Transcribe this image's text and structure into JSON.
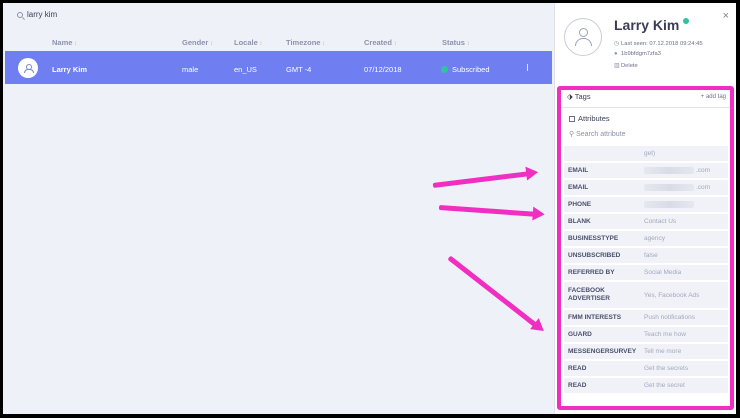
{
  "search": {
    "query": "larry kim"
  },
  "columns": [
    "Name",
    "Gender",
    "Locale",
    "Timezone",
    "Created",
    "Status"
  ],
  "row": {
    "name": "Larry Kim",
    "gender": "male",
    "locale": "en_US",
    "timezone": "GMT -4",
    "created": "07/12/2018",
    "status": "Subscribed",
    "status_color": "#2fc3a1"
  },
  "panel": {
    "name": "Larry Kim",
    "last_seen": "Last seen: 07.12.2018 09:24:45",
    "user_id": "1b9bfdgm7zfa3",
    "delete_label": "Delete",
    "close_label": "×",
    "tags_label": "Tags",
    "add_tag_label": "add tag",
    "attributes_label": "Attributes",
    "search_placeholder": "Search attribute",
    "partial_value": "get)",
    "attributes": [
      {
        "key": "EMAIL",
        "value": ".com",
        "masked": true
      },
      {
        "key": "EMAIL",
        "value": ".com",
        "masked": true
      },
      {
        "key": "PHONE",
        "value": "",
        "masked": true
      },
      {
        "key": "BLANK",
        "value": "Contact Us"
      },
      {
        "key": "BUSINESSTYPE",
        "value": "agency"
      },
      {
        "key": "UNSUBSCRIBED",
        "value": "false"
      },
      {
        "key": "REFERRED BY",
        "value": "Social Media"
      },
      {
        "key": "FACEBOOK ADVERTISER",
        "value": "Yes, Facebook Ads"
      },
      {
        "key": "FMM INTERESTS",
        "value": "Push notifications"
      },
      {
        "key": "GUARD",
        "value": "Teach me how"
      },
      {
        "key": "MESSENGERSURVEY",
        "value": "Tell me more"
      },
      {
        "key": "READ",
        "value": "Get the secrets"
      },
      {
        "key": "READ",
        "value": "Get the secret"
      }
    ]
  },
  "colors": {
    "accent": "#6f7ff2",
    "highlight": "#f02fc2",
    "online": "#2fc3a1"
  }
}
